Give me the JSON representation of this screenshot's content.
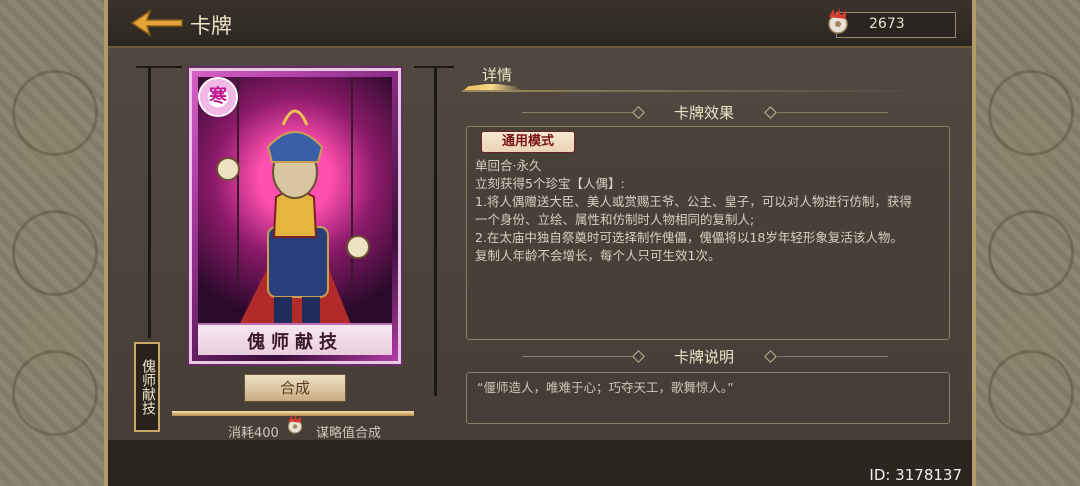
{
  "header": {
    "title": "卡牌",
    "currency_value": "2673"
  },
  "card": {
    "badge": "寒",
    "name": "傀师献技",
    "vertical_label": "傀师献技",
    "synthesize_label": "合成",
    "cost_label": "消耗400",
    "cost_note": "谋略值合成",
    "progress": 1.0,
    "rarity_color": "#b23aa6"
  },
  "details": {
    "tab_label": "详情",
    "effect_title": "卡牌效果",
    "mode_tag": "通用模式",
    "effect_lines": [
      "单回合·永久",
      "立刻获得5个珍宝【人偶】:",
      "1.将人偶赠送大臣、美人或赏赐王爷、公主、皇子，可以对人物进行仿制，获得",
      "一个身份、立绘、属性和仿制时人物相同的复制人;",
      "2.在太庙中独自祭奠时可选择制作傀儡，傀儡将以18岁年轻形象复活该人物。",
      "复制人年龄不会增长，每个人只可生效1次。"
    ],
    "description_title": "卡牌说明",
    "description_text": "“偃师造人，唯难于心；巧夺天工，歌舞惊人。”"
  },
  "footer": {
    "id_text": "ID: 3178137"
  },
  "colors": {
    "gold": "#e7b94c",
    "panel": "#4a423a",
    "text": "#f0e4c8"
  },
  "icons": [
    "back-arrow-icon",
    "feather-coin-icon",
    "feather-coin-icon"
  ]
}
